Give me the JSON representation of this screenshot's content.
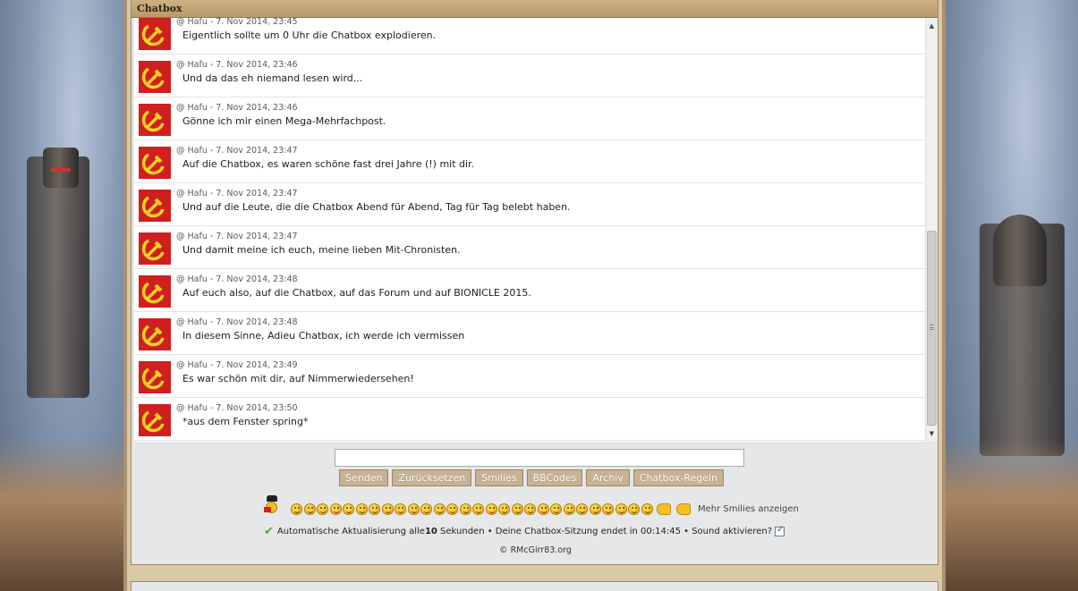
{
  "chatbox": {
    "title": "Chatbox",
    "messages": [
      {
        "meta": "@ Hafu - 7. Nov 2014, 23:45",
        "text": "Eigentlich sollte um 0 Uhr die Chatbox explodieren."
      },
      {
        "meta": "@ Hafu - 7. Nov 2014, 23:46",
        "text": "Und da das eh niemand lesen wird..."
      },
      {
        "meta": "@ Hafu - 7. Nov 2014, 23:46",
        "text": "Gönne ich mir einen Mega-Mehrfachpost."
      },
      {
        "meta": "@ Hafu - 7. Nov 2014, 23:47",
        "text": "Auf die Chatbox, es waren schöne fast drei Jahre (!) mit dir."
      },
      {
        "meta": "@ Hafu - 7. Nov 2014, 23:47",
        "text": "Und auf die Leute, die die Chatbox Abend für Abend, Tag für Tag belebt haben."
      },
      {
        "meta": "@ Hafu - 7. Nov 2014, 23:47",
        "text": "Und damit meine ich euch, meine lieben Mit-Chronisten."
      },
      {
        "meta": "@ Hafu - 7. Nov 2014, 23:48",
        "text": "Auf euch also, auf die Chatbox, auf das Forum und auf BIONICLE 2015."
      },
      {
        "meta": "@ Hafu - 7. Nov 2014, 23:48",
        "text": "In diesem Sinne, Adieu Chatbox, ich werde ich vermissen"
      },
      {
        "meta": "@ Hafu - 7. Nov 2014, 23:49",
        "text": "Es war schön mit dir, auf Nimmerwiedersehen!"
      },
      {
        "meta": "@ Hafu - 7. Nov 2014, 23:50",
        "text": "*aus dem Fenster spring*"
      }
    ],
    "input": {
      "value": "",
      "placeholder": ""
    },
    "buttons": {
      "send": "Senden",
      "reset": "Zurücksetzen",
      "smilies": "Smilies",
      "bbcodes": "BBCodes",
      "archive": "Archiv",
      "rules": "Chatbox-Regeln"
    },
    "more_smilies": "Mehr Smilies anzeigen",
    "status": {
      "part1": "Automatische Aktualisierung alle ",
      "interval": "10",
      "part2": " Sekunden • Deine Chatbox-Sitzung endet in 00:14:45 • Sound aktivieren?",
      "sound_enabled": true
    },
    "copyright": "© RMcGirr83.org"
  },
  "colors": {
    "avatar_red": "#d01f1f",
    "button_bg": "#c7b394",
    "panel_title": "#b99a6a"
  }
}
